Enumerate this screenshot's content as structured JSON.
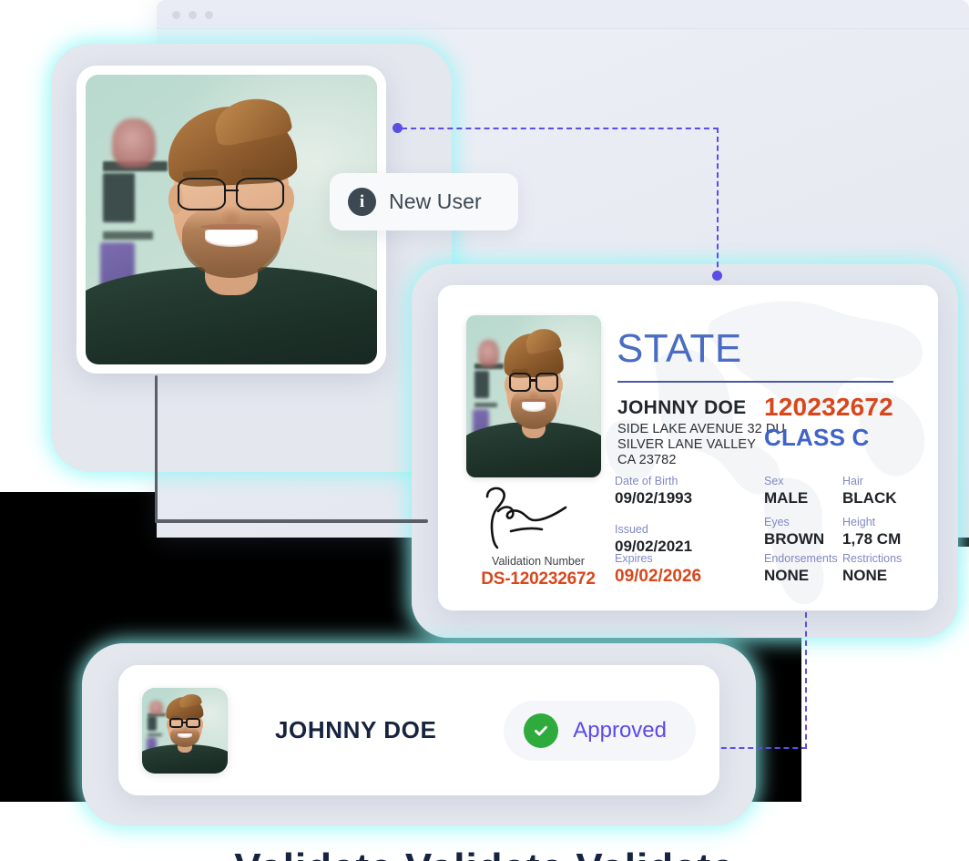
{
  "window": {
    "traffic_lights": [
      "close",
      "minimize",
      "maximize"
    ]
  },
  "badge": {
    "icon": "info-icon",
    "label": "New User"
  },
  "id_card": {
    "state_title": "STATE",
    "holder_name": "JOHNNY DOE",
    "address": "SIDE LAKE AVENUE 32 DU\nSILVER LANE VALLEY\nCA 23782",
    "license_number": "120232672",
    "license_class": "CLASS C",
    "validation_label": "Validation Number",
    "validation_value": "DS-120232672",
    "fields": [
      {
        "label": "Date of Birth",
        "value": "09/02/1993"
      },
      {
        "label": "Issued",
        "value": "09/02/2021"
      },
      {
        "label": "Expires",
        "value": "09/02/2026"
      },
      {
        "label": "Sex",
        "value": "MALE"
      },
      {
        "label": "Eyes",
        "value": "BROWN"
      },
      {
        "label": "Endorsements",
        "value": "NONE"
      },
      {
        "label": "Hair",
        "value": "BLACK"
      },
      {
        "label": "Height",
        "value": "1,78 CM"
      },
      {
        "label": "Restrictions",
        "value": "NONE"
      }
    ]
  },
  "approval": {
    "name": "JOHNNY DOE",
    "status": "Approved",
    "status_icon": "check-circle-icon"
  },
  "footer": {
    "cut_text": "Validate  Validate  Validate"
  },
  "colors": {
    "accent_purple": "#5b4ee6",
    "state_blue": "#4a6cc2",
    "license_orange": "#d8471b",
    "class_blue": "#3f63c7",
    "field_label_blue": "#8089c4",
    "approved_green": "#2eab3c",
    "approved_text": "#5b4ae8",
    "glow_cyan": "#8cf7f7"
  }
}
